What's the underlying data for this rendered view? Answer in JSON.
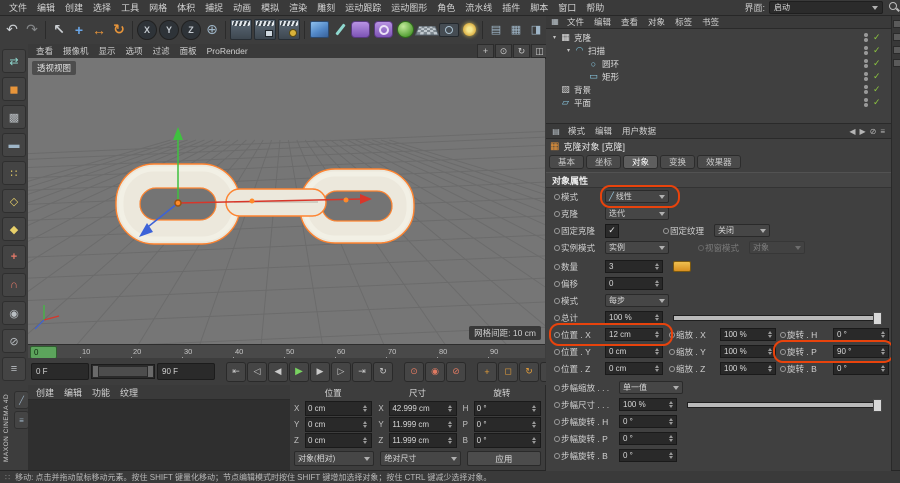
{
  "colors": {
    "annotation_orange": "#e8430c",
    "selection_orange": "#ff8430",
    "check_green": "#8dc63f",
    "play_green": "#79d361",
    "playhead_green": "#5ca45c",
    "viewport_gray": "#767676"
  },
  "menubar": {
    "items": [
      "文件",
      "编辑",
      "创建",
      "选择",
      "工具",
      "网格",
      "体积",
      "捕捉",
      "动画",
      "模拟",
      "渲染",
      "雕刻",
      "运动跟踪",
      "运动图形",
      "角色",
      "流水线",
      "插件",
      "脚本",
      "窗口",
      "帮助"
    ],
    "interface_label": "界面:",
    "interface_value": "启动"
  },
  "toolbar": {
    "icons": [
      {
        "name": "undo-button",
        "glyph": "↶",
        "cls": "ticon big"
      },
      {
        "name": "redo-button",
        "glyph": "↷",
        "cls": "ticon big dim"
      },
      {
        "name": "toolbar-separator",
        "glyph": "",
        "cls": "tsep"
      },
      {
        "name": "live-selection-tool",
        "glyph": "↖",
        "cls": "ticon big bold"
      },
      {
        "name": "move-tool",
        "glyph": "+",
        "cls": "ticon big bold c-blue"
      },
      {
        "name": "scale-tool",
        "glyph": "↔",
        "cls": "ticon big bold c-orange"
      },
      {
        "name": "rotate-tool",
        "glyph": "↻",
        "cls": "ticon big bold c-orange"
      },
      {
        "name": "toolbar-separator",
        "glyph": "",
        "cls": "tsep"
      },
      {
        "name": "x-axis-lock-button",
        "glyph": "X",
        "cls": "xyzbtn"
      },
      {
        "name": "y-axis-lock-button",
        "glyph": "Y",
        "cls": "xyzbtn"
      },
      {
        "name": "z-axis-lock-button",
        "glyph": "Z",
        "cls": "xyzbtn"
      },
      {
        "name": "coordinate-system-button",
        "glyph": "⊕",
        "cls": "ticon big c-steel"
      },
      {
        "name": "toolbar-separator",
        "glyph": "",
        "cls": "tsep"
      },
      {
        "name": "render-view-button",
        "glyph": "",
        "cls": "clap"
      },
      {
        "name": "render-picture-viewer-button",
        "glyph": "",
        "cls": "clap pv"
      },
      {
        "name": "edit-render-settings-button",
        "glyph": "",
        "cls": "clap gear"
      },
      {
        "name": "toolbar-separator",
        "glyph": "",
        "cls": "tsep"
      },
      {
        "name": "primitive-cube-menu",
        "glyph": "",
        "cls": "cubeic"
      },
      {
        "name": "spline-pen-menu",
        "glyph": "",
        "cls": "penic"
      },
      {
        "name": "subdivision-surface-menu",
        "glyph": "",
        "cls": "pill"
      },
      {
        "name": "modeling-generators-menu",
        "glyph": "",
        "cls": "pill ring"
      },
      {
        "name": "volume-menu",
        "glyph": "",
        "cls": "ballic"
      },
      {
        "name": "floor-menu",
        "glyph": "",
        "cls": "flooric"
      },
      {
        "name": "camera-menu",
        "glyph": "",
        "cls": "camic"
      },
      {
        "name": "light-menu",
        "glyph": "",
        "cls": "lightic"
      },
      {
        "name": "toolbar-separator",
        "glyph": "",
        "cls": "tsep"
      },
      {
        "name": "display-layout-button",
        "glyph": "▤",
        "cls": "ticon c-steel"
      },
      {
        "name": "grid-layout-button",
        "glyph": "▦",
        "cls": "ticon c-steel"
      },
      {
        "name": "split-view-button",
        "glyph": "◨",
        "cls": "ticon c-steel"
      }
    ]
  },
  "left_toolbar": {
    "icons": [
      {
        "name": "make-editable-button",
        "glyph": "⇄",
        "cls": "licon c-mint"
      },
      {
        "name": "model-mode-button",
        "glyph": "◼",
        "cls": "licon c-orange"
      },
      {
        "name": "texture-mode-button",
        "glyph": "▩",
        "cls": "licon c-gray"
      },
      {
        "name": "workplane-mode-button",
        "glyph": "▬",
        "cls": "licon c-steel"
      },
      {
        "name": "points-mode-button",
        "glyph": "∷",
        "cls": "licon c-yellow"
      },
      {
        "name": "edges-mode-button",
        "glyph": "◇",
        "cls": "licon c-yellow"
      },
      {
        "name": "polygons-mode-button",
        "glyph": "◆",
        "cls": "licon c-yellow"
      },
      {
        "name": "enable-axis-button",
        "glyph": "+",
        "cls": "licon c-red bold"
      },
      {
        "name": "snap-toggle-button",
        "glyph": "∩",
        "cls": "licon c-red"
      },
      {
        "name": "workplane-snap-button",
        "glyph": "◉",
        "cls": "licon c-gray"
      },
      {
        "name": "lock-button",
        "glyph": "⊘",
        "cls": "licon c-gray"
      },
      {
        "name": "filter-list-button",
        "glyph": "≡",
        "cls": "licon c-gray"
      }
    ],
    "bottom_icons": [
      {
        "name": "pen-shortcut-button",
        "glyph": "╱",
        "cls": "licon sm c-steel"
      },
      {
        "name": "layers-shortcut-button",
        "glyph": "≡",
        "cls": "licon sm c-steel"
      }
    ]
  },
  "viewport": {
    "menu": [
      "查看",
      "摄像机",
      "显示",
      "选项",
      "过滤",
      "面板",
      "ProRender"
    ],
    "nav_icons": [
      {
        "name": "pan-view-button",
        "glyph": "+"
      },
      {
        "name": "zoom-view-button",
        "glyph": "⊙"
      },
      {
        "name": "rotate-view-button",
        "glyph": "↻"
      },
      {
        "name": "toggle-views-button",
        "glyph": "◫"
      }
    ],
    "view_label": "透视视图",
    "grid_info": "网格间距: 10 cm"
  },
  "timeline": {
    "playhead": "0",
    "ticks": [
      "10",
      "20",
      "30",
      "40",
      "50",
      "60",
      "70",
      "80",
      "90"
    ],
    "start_field": "0 F",
    "end_field": "90 F",
    "transport": [
      {
        "name": "goto-start-button",
        "glyph": "⇤",
        "cls": "tbtn"
      },
      {
        "name": "prev-key-button",
        "glyph": "◁",
        "cls": "tbtn"
      },
      {
        "name": "prev-frame-button",
        "glyph": "◀",
        "cls": "tbtn"
      },
      {
        "name": "play-button",
        "glyph": "▶",
        "cls": "tbtn play"
      },
      {
        "name": "next-frame-button",
        "glyph": "▶",
        "cls": "tbtn"
      },
      {
        "name": "next-key-button",
        "glyph": "▷",
        "cls": "tbtn"
      },
      {
        "name": "goto-end-button",
        "glyph": "⇥",
        "cls": "tbtn"
      },
      {
        "name": "loop-mode-button",
        "glyph": "↻",
        "cls": "tbtn"
      }
    ],
    "record_icons": [
      {
        "name": "record-keyframe-button",
        "glyph": "⊙",
        "cls": "tbtn rec"
      },
      {
        "name": "autokeying-button",
        "glyph": "◉",
        "cls": "tbtn rec"
      },
      {
        "name": "keyframe-selection-button",
        "glyph": "⊘",
        "cls": "tbtn rec"
      }
    ],
    "keying_icons": [
      {
        "name": "record-position-toggle",
        "glyph": "+",
        "cls": "tbtn okey"
      },
      {
        "name": "record-scale-toggle",
        "glyph": "◻",
        "cls": "tbtn okey"
      },
      {
        "name": "record-rotation-toggle",
        "glyph": "↻",
        "cls": "tbtn okey"
      },
      {
        "name": "record-parameter-toggle",
        "glyph": "P",
        "cls": "tbtn oP"
      },
      {
        "name": "record-pla-toggle",
        "glyph": "∷",
        "cls": "tbtn okey"
      }
    ]
  },
  "materials": {
    "tabs": [
      "创建",
      "编辑",
      "功能",
      "纹理"
    ]
  },
  "brand": "MAXON CINEMA 4D",
  "coords": {
    "columns": [
      {
        "title": "位置",
        "rows": [
          {
            "k": "X",
            "v": "0 cm"
          },
          {
            "k": "Y",
            "v": "0 cm"
          },
          {
            "k": "Z",
            "v": "0 cm"
          }
        ]
      },
      {
        "title": "尺寸",
        "rows": [
          {
            "k": "X",
            "v": "42.999 cm"
          },
          {
            "k": "Y",
            "v": "11.999 cm"
          },
          {
            "k": "Z",
            "v": "11.999 cm"
          }
        ]
      },
      {
        "title": "旋转",
        "rows": [
          {
            "k": "H",
            "v": "0 °"
          },
          {
            "k": "P",
            "v": "0 °"
          },
          {
            "k": "B",
            "v": "0 °"
          }
        ]
      }
    ],
    "mode_dropdown": "对象(相对)",
    "size_dropdown": "绝对尺寸",
    "apply_label": "应用"
  },
  "object_manager": {
    "menu_icon_glyph": "▦",
    "menu": [
      "文件",
      "编辑",
      "查看",
      "对象",
      "标签",
      "书签"
    ],
    "tree": [
      {
        "label": "克隆",
        "ind": "ind ind0",
        "exp": "▾",
        "icon_cls": "oicon ic-cloner",
        "icon_glyph": "▦",
        "icon_name": "cloner-icon",
        "check": "✓"
      },
      {
        "label": "扫描",
        "ind": "ind ind1",
        "exp": "▾",
        "icon_cls": "oicon ic-sweep",
        "icon_glyph": "◠",
        "icon_name": "sweep-icon",
        "check": "✓"
      },
      {
        "label": "圆环",
        "ind": "ind ind2",
        "exp": "",
        "icon_cls": "oicon ic-spline",
        "icon_glyph": "○",
        "icon_name": "circle-spline-icon",
        "check": "✓"
      },
      {
        "label": "矩形",
        "ind": "ind ind2",
        "exp": "",
        "icon_cls": "oicon ic-spline",
        "icon_glyph": "▭",
        "icon_name": "rectangle-spline-icon",
        "check": "✓"
      },
      {
        "label": "背景",
        "ind": "ind ind0",
        "exp": "",
        "icon_cls": "oicon ic-bg",
        "icon_glyph": "▨",
        "icon_name": "background-icon",
        "check": "✓"
      },
      {
        "label": "平面",
        "ind": "ind ind0",
        "exp": "",
        "icon_cls": "oicon ic-plane",
        "icon_glyph": "▱",
        "icon_name": "plane-icon",
        "check": "✓"
      }
    ]
  },
  "attributes": {
    "mode_icon_glyph": "▤",
    "mode_tabs": [
      "模式",
      "编辑",
      "用户数据"
    ],
    "nav_icons": [
      {
        "name": "history-back-button",
        "glyph": "◀"
      },
      {
        "name": "history-forward-button",
        "glyph": "▶"
      },
      {
        "name": "lock-attributes-button",
        "glyph": "⊘"
      },
      {
        "name": "attributes-menu-button",
        "glyph": "≡"
      }
    ],
    "title_icon_glyph": "▦",
    "title": "克隆对象 [克隆]",
    "tabs": [
      {
        "label": "基本",
        "cls": "atab"
      },
      {
        "label": "坐标",
        "cls": "atab"
      },
      {
        "label": "对象",
        "cls": "atab active"
      },
      {
        "label": "变换",
        "cls": "atab"
      },
      {
        "label": "效果器",
        "cls": "atab"
      }
    ],
    "section": "对象属性",
    "props": {
      "mode": {
        "label": "模式",
        "value": "线性",
        "icon": "╱"
      },
      "clone": {
        "label": "克隆",
        "value": "迭代"
      },
      "fix_clone": {
        "label": "固定克隆"
      },
      "fix_texture": {
        "label": "固定纹理",
        "value": "关闭"
      },
      "instance_mode": {
        "label": "实例模式",
        "value": "实例"
      },
      "viewport_mode": {
        "label": "视窗模式",
        "value": "对象"
      },
      "count": {
        "label": "数量",
        "value": "3"
      },
      "offset": {
        "label": "偏移",
        "value": "0"
      },
      "step_mode": {
        "label": "模式",
        "value": "每步"
      },
      "total": {
        "label": "总计",
        "value": "100 %"
      },
      "pos_x": {
        "label": "位置 . X",
        "value": "12 cm"
      },
      "scale_x": {
        "label": "缩放 . X",
        "value": "100 %"
      },
      "rot_h": {
        "label": "旋转 . H",
        "value": "0 °"
      },
      "pos_y": {
        "label": "位置 . Y",
        "value": "0 cm"
      },
      "scale_y": {
        "label": "缩放 . Y",
        "value": "100 %"
      },
      "rot_p": {
        "label": "旋转 . P",
        "value": "90 °"
      },
      "pos_z": {
        "label": "位置 . Z",
        "value": "0 cm"
      },
      "scale_z": {
        "label": "缩放 . Z",
        "value": "100 %"
      },
      "rot_b": {
        "label": "旋转 . B",
        "value": "0 °"
      },
      "step_scale": {
        "label": "步幅缩放 . . .",
        "value": "单一值"
      },
      "step_size": {
        "label": "步幅尺寸 . . .",
        "value": "100 %"
      },
      "step_rot_h": {
        "label": "步幅旋转 . H",
        "value": "0 °"
      },
      "step_rot_p": {
        "label": "步幅旋转 . P",
        "value": "0 °"
      },
      "step_rot_b": {
        "label": "步幅旋转 . B",
        "value": "0 °"
      }
    }
  },
  "status": {
    "grip_glyph": "∷",
    "text": "移动: 点击并拖动鼠标移动元素。按住 SHIFT 键量化移动；节点编辑模式时按住 SHIFT 键增加选择对象；按住 CTRL 键减少选择对象。"
  },
  "side_strip": {
    "icons": [
      {
        "name": "dock-tab-icon"
      },
      {
        "name": "dock-tab-icon"
      },
      {
        "name": "dock-tab-icon"
      },
      {
        "name": "dock-tab-icon"
      }
    ]
  }
}
